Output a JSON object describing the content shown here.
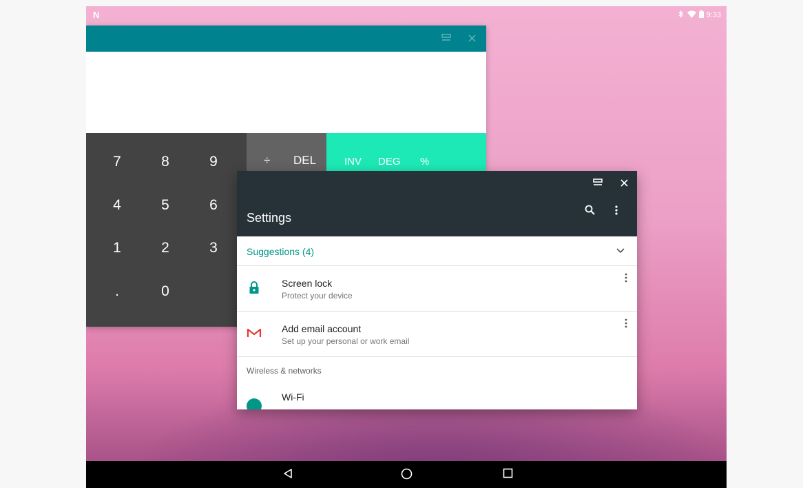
{
  "statusbar": {
    "logo": "N",
    "time": "9:33",
    "bluetooth_icon": "bluetooth-icon",
    "wifi_icon": "wifi-icon",
    "battery_icon": "battery-icon"
  },
  "calculator": {
    "caption_buttons": [
      "maximize-icon",
      "close-icon"
    ],
    "num_keys": [
      [
        "7",
        "8",
        "9"
      ],
      [
        "4",
        "5",
        "6"
      ],
      [
        "1",
        "2",
        "3"
      ],
      [
        ".",
        "0",
        ""
      ]
    ],
    "op_keys": [
      "÷",
      "DEL"
    ],
    "adv_keys": [
      "INV",
      "DEG",
      "%"
    ],
    "colors": {
      "caption": "#00838f",
      "numpad": "#434343",
      "oppad": "#636363",
      "advpad": "#1de9b6"
    }
  },
  "settings": {
    "title": "Settings",
    "suggestions_label": "Suggestions (4)",
    "items": [
      {
        "title": "Screen lock",
        "subtitle": "Protect your device",
        "icon": "lock-icon"
      },
      {
        "title": "Add email account",
        "subtitle": "Set up your personal or work email",
        "icon": "gmail-icon"
      }
    ],
    "section_header": "Wireless & networks",
    "partial_item": "Wi-Fi",
    "colors": {
      "toolbar": "#263238",
      "accent": "#009688"
    }
  },
  "navbar": {
    "buttons": [
      "back-icon",
      "home-icon",
      "recents-icon"
    ]
  }
}
